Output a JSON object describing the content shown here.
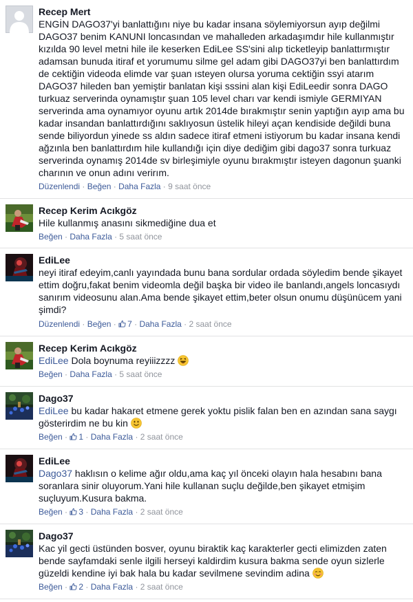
{
  "labels": {
    "edit": "Düzenlendi",
    "like": "Beğen",
    "more": "Daha Fazla",
    "sep": " · "
  },
  "colors": {
    "link": "#3b5998",
    "meta": "#90949c",
    "text": "#141823",
    "divider": "#e1e2e3"
  },
  "comments": [
    {
      "author": "Recep Mert",
      "avatar_icon": "default-profile-silhouette-icon",
      "text_lines": [
        "ENGİN DAGO37'yi banlattığını niye bu kadar insana söylemiyorsun ayıp değilmi",
        "DAGO37 benim KANUNI loncasından ve mahalleden arkadaşımdır hile kullanmıştır",
        "kızılda 90 level metni hile ile keserken EdiLee SS'sini alıp ticketleyip banlattırmıştır",
        "adamsan bunuda itiraf et yorumumu silme gel adam gibi DAGO37yi ben banlattırdım",
        "de cektiğin videoda elimde var şuan ısteyen olursa yoruma cektiğin ssyi atarım",
        "DAGO37 hileden ban yemiştir banlatan kişi sssini alan kişi EdiLeedir sonra DAGO",
        "turkuaz serverinda oynamıştır şuan 105 level charı var kendi ismiyle GERMIYAN",
        "serverinda ama oynamıyor oyunu artık 2014de bırakmıştır senin yaptığın ayıp ama bu",
        "kadar insandan banlattırdığını saklıyosun üstelik hileyi açan kendiside değildi buna",
        "sende biliyordun yinede ss aldın sadece itiraf etmeni istiyorum bu kadar insana kendi",
        "ağzınla ben banlattırdım hile kullandığı için diye dediğim gibi dago37 sonra turkuaz",
        "serverinda oynamış 2014de sv birleşimiyle oyunu bırakmıştır isteyen dagonun şuanki",
        "charının ve onun adını verirım."
      ],
      "edited": true,
      "likes": "",
      "time": "9 saat önce"
    },
    {
      "author": "Recep Kerim Acıkgöz",
      "avatar_icon": "profile-photo-person-icon",
      "text_lines": [
        "Hile kullanmış anasını sikmediğine dua et"
      ],
      "edited": false,
      "likes": "",
      "time": "5 saat önce"
    },
    {
      "author": "EdiLee",
      "avatar_icon": "profile-photo-game-character-icon",
      "text_lines": [
        "neyi itiraf edeyim,canlı yayındada bunu bana sordular ordada söyledim bende şikayet",
        "ettim doğru,fakat benim videomla değil başka bir video ile banlandı,angels loncasıydı",
        "sanırım videosunu alan.Ama bende şikayet ettim,beter olsun onumu düşünücem yani",
        "şimdi?"
      ],
      "edited": true,
      "likes": "7",
      "time": "2 saat önce"
    },
    {
      "author": "Recep Kerim Acıkgöz",
      "avatar_icon": "profile-photo-person-icon",
      "mention": "EdiLee",
      "text_lines": [
        " Dola boynuma reyiiizzzz "
      ],
      "emoji": "laughing-emoji-icon",
      "edited": false,
      "likes": "",
      "time": "5 saat önce"
    },
    {
      "author": "Dago37",
      "avatar_icon": "profile-photo-game-scene-icon",
      "mention": "EdiLee",
      "text_lines": [
        " bu kadar hakaret etmene gerek yoktu pislik falan ben en azından sana saygı",
        "gösterirdim ne bu kin "
      ],
      "emoji": "smile-emoji-icon",
      "edited": false,
      "likes": "1",
      "time": "2 saat önce"
    },
    {
      "author": "EdiLee",
      "avatar_icon": "profile-photo-game-character-icon",
      "mention": "Dago37",
      "text_lines": [
        " haklısın o kelime ağır oldu,ama kaç yıl önceki olayın hala hesabını bana",
        "soranlara sinir oluyorum.Yani hile kullanan suçlu değilde,ben şikayet etmişim",
        "suçluyum.Kusura bakma."
      ],
      "edited": false,
      "likes": "3",
      "time": "2 saat önce"
    },
    {
      "author": "Dago37",
      "avatar_icon": "profile-photo-game-scene-icon",
      "text_lines": [
        "Kac yil gecti üstünden bosver, oyunu biraktik kaç karakterler gecti elimizden zaten",
        "bende sayfamdaki senle ilgili herseyi kaldirdim kusura bakma sende oyun sizlerle",
        "güzeldi kendine iyi bak hala bu kadar sevilmene sevindim adina "
      ],
      "emoji": "blush-emoji-icon",
      "edited": false,
      "likes": "2",
      "time": "2 saat önce"
    }
  ]
}
